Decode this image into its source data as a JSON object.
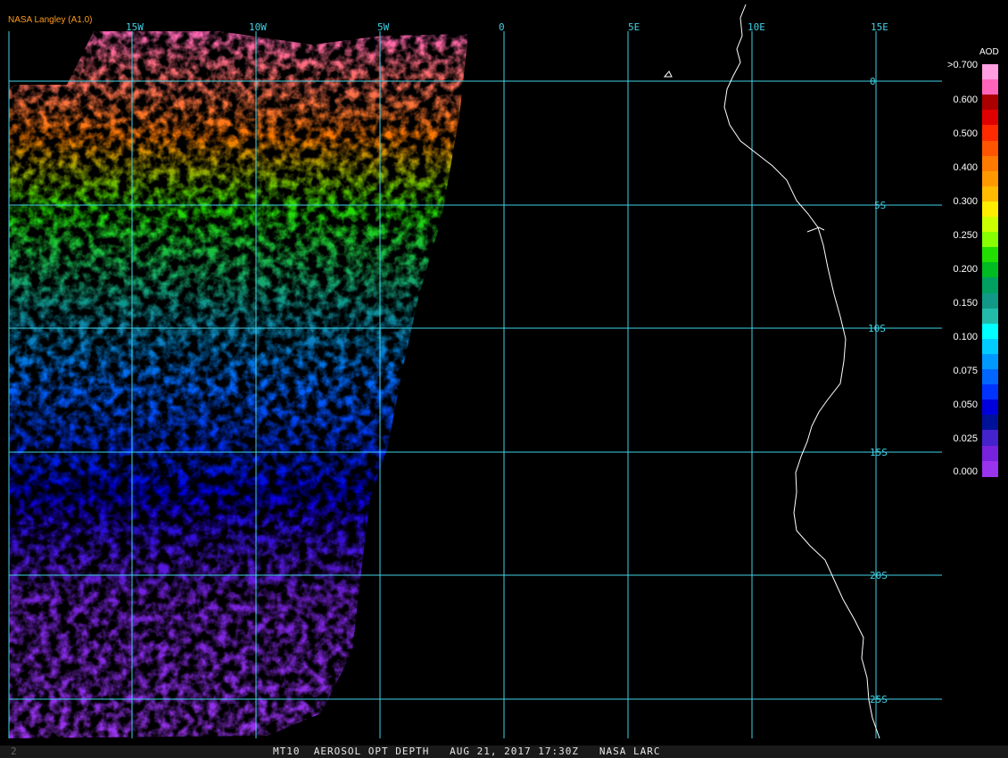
{
  "credit": "NASA Langley (A1.0)",
  "footer": "MT10  AEROSOL OPT DEPTH   AUG 21, 2017 17:30Z   NASA LARC",
  "corner_mark": "2",
  "grid": {
    "lon_labels": [
      "15W",
      "10W",
      "5W",
      "0",
      "5E",
      "10E",
      "15E"
    ],
    "lat_labels": [
      "0",
      "5S",
      "10S",
      "15S",
      "20S",
      "25S"
    ]
  },
  "legend": {
    "title": "AOD",
    "labels": [
      ">0.700",
      "0.600",
      "0.500",
      "0.400",
      "0.300",
      "0.250",
      "0.200",
      "0.150",
      "0.100",
      "0.075",
      "0.050",
      "0.025",
      "0.000"
    ],
    "colors": [
      "#ff9ee0",
      "#ff66bb",
      "#aa0000",
      "#e00000",
      "#ff2a00",
      "#ff5500",
      "#ff7a00",
      "#ff9900",
      "#ffbb00",
      "#ffee00",
      "#ccff00",
      "#88ff00",
      "#22dd00",
      "#00bb22",
      "#00a060",
      "#119988",
      "#22bbaa",
      "#00ffff",
      "#00ccff",
      "#0099ff",
      "#0066ff",
      "#0033ff",
      "#0000dd",
      "#001199",
      "#4422cc",
      "#7722dd",
      "#9933ee"
    ]
  },
  "map_colors": {
    "gridline": "#3fd2e6",
    "coastline": "#ffffff"
  }
}
